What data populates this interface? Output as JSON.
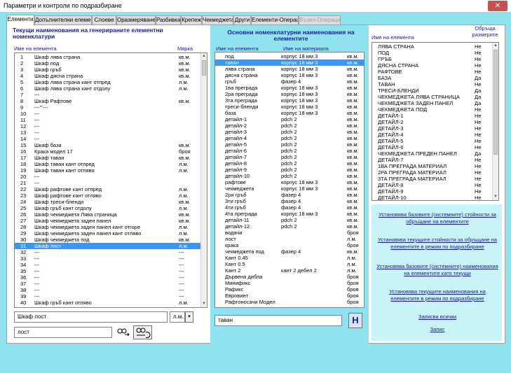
{
  "window": {
    "title": "Параметри и контроли по подразбиране",
    "close": "✕"
  },
  "tabs": [
    {
      "label": "Елементи",
      "active": true
    },
    {
      "label": "Допълнителни елементи"
    },
    {
      "label": "Слоеве"
    },
    {
      "label": "Оразмеряване"
    },
    {
      "label": "Разбивка"
    },
    {
      "label": "Крепеж"
    },
    {
      "label": "Чекмеджета"
    },
    {
      "label": "Други"
    },
    {
      "label": "Елементи-Операции"
    },
    {
      "label": "Възел-Операции",
      "disabled": true
    }
  ],
  "left": {
    "title": "Текущи наименования на генерираните елементни номенклатури",
    "col_name": "Име на елемента",
    "col_unit": "Мярка",
    "rows": [
      [
        "1",
        "Шкаф лява страна",
        "кв.м."
      ],
      [
        "2",
        "Шкаф под",
        "кв.м."
      ],
      [
        "3",
        "Шкаф гръб",
        "кв.м."
      ],
      [
        "4",
        "Шкаф дясна страна",
        "кв.м."
      ],
      [
        "5",
        "Шкаф лява страна кант отпред",
        "л.м."
      ],
      [
        "6",
        "Шкаф лява страна кант отдолу",
        "л.м."
      ],
      [
        "7",
        "---",
        ""
      ],
      [
        "8",
        "Шкаф Рафтове",
        "кв.м."
      ],
      [
        "9",
        "---'''---",
        ""
      ],
      [
        "10",
        "---",
        ""
      ],
      [
        "11",
        "---",
        ""
      ],
      [
        "12",
        "---",
        ""
      ],
      [
        "13",
        "---",
        ""
      ],
      [
        "14",
        "---",
        ""
      ],
      [
        "15",
        "Шкаф база",
        "кв.м."
      ],
      [
        "16",
        "Крака модел 17",
        "броя"
      ],
      [
        "17",
        "Шкаф таван",
        "кв.м."
      ],
      [
        "18",
        "Шкаф таван кант отпред",
        "л.м."
      ],
      [
        "19",
        "Шкаф таван кант отляво",
        "л.м."
      ],
      [
        "20",
        "---",
        ""
      ],
      [
        "21",
        "---",
        ""
      ],
      [
        "22",
        "Шкаф рафтове кант отпред",
        "л.м."
      ],
      [
        "23",
        "Шкаф рафтове кант отляво",
        "л.м."
      ],
      [
        "24",
        "Шкаф треси-бленди",
        "кв.м."
      ],
      [
        "25",
        "Шкаф гръб кант отдолу",
        "л.м."
      ],
      [
        "26",
        "Шкаф чекмеджета Лява страница",
        "кв.м."
      ],
      [
        "27",
        "Шкаф чекмеджета заден панел",
        "кв.м."
      ],
      [
        "28",
        "Шкаф чекмеджета заден панел кант отгоре",
        "л.м."
      ],
      [
        "29",
        "Шкаф чекмеджета заден панел кант отляво",
        "л.м."
      ],
      [
        "30",
        "Шкаф чекмеджета под",
        "кв.м."
      ],
      [
        "31",
        "Шкаф лост",
        "л.м."
      ],
      [
        "32",
        "---",
        "---"
      ],
      [
        "33",
        "---",
        "---"
      ],
      [
        "34",
        "---",
        "---"
      ],
      [
        "35",
        "---",
        "---"
      ],
      [
        "36",
        "---",
        "---"
      ],
      [
        "37",
        "---",
        "---"
      ],
      [
        "38",
        "---",
        "---"
      ],
      [
        "39",
        "---",
        "---"
      ],
      [
        "40",
        "Шкаф гръб кант отляво",
        "л.м."
      ]
    ],
    "selected_index": 30,
    "edit_name": "Шкаф лост",
    "edit_unit": "л.м.",
    "search_value": "лост"
  },
  "middle": {
    "title": "Основни номенклатурни наименования на елементите",
    "col_name": "Име на елемента",
    "col_mat": "Име на материала",
    "rows": [
      [
        "под",
        "корпус 18 мм 3",
        "кв.м."
      ],
      [
        "таван",
        "корпус 18 мм 3",
        "кв.м."
      ],
      [
        "лява страна",
        "корпус 18 мм 3",
        "кв.м."
      ],
      [
        "дясна страна",
        "корпус 18 мм 3",
        "кв.м."
      ],
      [
        "гръб",
        "фазер 4",
        "кв.м."
      ],
      [
        "1ва преграда",
        "корпус 18 мм 3",
        "кв.м."
      ],
      [
        "2ра преграда",
        "корпус 18 мм 3",
        "кв.м."
      ],
      [
        "3та преграда",
        "корпус 18 мм 3",
        "кв.м."
      ],
      [
        "треси-бленди",
        "корпус 18 мм 3",
        "кв.м."
      ],
      [
        "база",
        "корпус 18 мм 3",
        "кв.м."
      ],
      [
        "детайл-1",
        "pdch 2",
        "кв.м."
      ],
      [
        "детайл-2",
        "pdch 2",
        "кв.м."
      ],
      [
        "детайл-3",
        "pdch 2",
        "кв.м."
      ],
      [
        "детайл-4",
        "pdch 2",
        "кв.м."
      ],
      [
        "детайл-5",
        "pdch 2",
        "кв.м."
      ],
      [
        "детайл-6",
        "pdch 2",
        "кв.м."
      ],
      [
        "детайл-7",
        "pdch 2",
        "кв.м."
      ],
      [
        "детайл-8",
        "pdch 2",
        "кв.м."
      ],
      [
        "детайл-9",
        "pdch 2",
        "кв.м."
      ],
      [
        "детайл-10",
        "pdch 2",
        "кв.м."
      ],
      [
        "рафтове",
        "корпус 18 мм 3",
        "кв.м."
      ],
      [
        "чекмеджета",
        "корпус 18 мм 3",
        "кв.м."
      ],
      [
        "2ри гръб",
        "фазер 4",
        "кв.м."
      ],
      [
        "3ти гръб",
        "фазер 4",
        "кв.м."
      ],
      [
        "4ти гръб",
        "фазер 4",
        "кв.м."
      ],
      [
        "4та преграда",
        "корпус 18 мм 3",
        "кв.м."
      ],
      [
        "детайл-11",
        "pdch 2",
        "кв.м."
      ],
      [
        "детайл-12",
        "pdch 2",
        "кв.м."
      ],
      [
        "водачи",
        "",
        "броя"
      ],
      [
        "лост",
        "",
        "л.м."
      ],
      [
        "крака",
        "",
        "броя"
      ],
      [
        "чекмеджета под",
        "фазер 4",
        "кв.м."
      ],
      [
        "Кант 0.45",
        "",
        "л.м."
      ],
      [
        "Кант 0.5",
        "",
        "л.м."
      ],
      [
        "Кант 2",
        "кант 2 дебел 2",
        "л.м."
      ],
      [
        "Дървена дибла",
        "",
        "броя"
      ],
      [
        "Минификс",
        "",
        "броя"
      ],
      [
        "Рафикс",
        "",
        "броя"
      ],
      [
        "Евровинт",
        "",
        "броя"
      ],
      [
        "Рафтоносачи Модел",
        "",
        "броя"
      ]
    ],
    "selected_index": 1,
    "edit_value": "таван",
    "h_button": "H"
  },
  "right": {
    "col_name": "Име на елемента",
    "col_flag": "Обръща размерите",
    "rows": [
      [
        "ЛЯВА СТРАНА",
        "Не"
      ],
      [
        "ПОД",
        "Не"
      ],
      [
        "ГРЪБ",
        "Не"
      ],
      [
        "ДЯСНА СТРАНА",
        "Не"
      ],
      [
        "РАФТОВЕ",
        "Не"
      ],
      [
        "БАЗА",
        "Да"
      ],
      [
        "ТАВАН",
        "Не"
      ],
      [
        "ТРЕСИ-БЛЕНДИ",
        "Да"
      ],
      [
        "ЧЕКМЕДЖЕТА ЛЯВА СТРАНИЦА",
        "Да"
      ],
      [
        "ЧЕКМЕДЖЕТА ЗАДЕН ПАНЕЛ",
        "Да"
      ],
      [
        "ЧЕКМЕДЖЕТА ПОД",
        "Не"
      ],
      [
        "ДЕТАЙЛ-1",
        "Не"
      ],
      [
        "ДЕТАЙЛ-2",
        "Не"
      ],
      [
        "ДЕТАЙЛ-3",
        "Не"
      ],
      [
        "ДЕТАЙЛ-4",
        "Не"
      ],
      [
        "ДЕТАЙЛ-5",
        "Не"
      ],
      [
        "ДЕТАЙЛ-6",
        "Не"
      ],
      [
        "ЧЕКМЕДЖЕТА ПРЕДЕН ПАНЕЛ",
        "Да"
      ],
      [
        "ДЕТАЙЛ-7",
        "Не"
      ],
      [
        "1ВА ПРЕГРАДА МАТЕРИАЛ",
        "Не"
      ],
      [
        "2РА ПРЕГРАДА МАТЕРИАЛ",
        "Не"
      ],
      [
        "3ТА ПРЕГРАДА МАТЕРИАЛ",
        "Не"
      ],
      [
        "ДЕТАЙЛ-8",
        "Не"
      ],
      [
        "ДЕТАЙЛ-9",
        "Не"
      ],
      [
        "ДЕТАЙЛ-10",
        "Не"
      ]
    ],
    "links": [
      "Установява базовите (системните) стойности за обръщане на елементите",
      "Установява текущите стойности за обръщане на елементите в режим по подразбиране",
      "Установява базовите (системните) наименования на елементите като текущи",
      "Установява текущите наименования на елементите в режим по подразбиране",
      "Записва всички",
      "Запис"
    ]
  },
  "icons": {
    "search_go": "binoculars-arrow-icon",
    "search_mode": "binoculars-undo-icon",
    "dropdown": "chevron-down-icon",
    "scroll_up": "arrow-up-icon",
    "scroll_down": "arrow-down-icon"
  },
  "colors": {
    "accent": "#1a1aa0",
    "selection": "#3399ff",
    "panel_bg": "#8fe3ef",
    "right_panel": "#c8f4f8"
  }
}
